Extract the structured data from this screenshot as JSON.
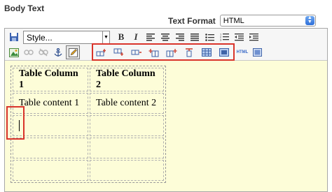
{
  "field": {
    "label": "Body Text"
  },
  "format": {
    "label": "Text Format",
    "selected": "HTML"
  },
  "toolbar": {
    "style_select": "Style...",
    "bold": "B",
    "italic": "I",
    "html_button": "HTML"
  },
  "table": {
    "headers": [
      "Table Column 1",
      "Table Column 2"
    ],
    "rows": [
      [
        "Table content 1",
        "Table content 2"
      ],
      [
        "",
        ""
      ],
      [
        "",
        ""
      ],
      [
        "",
        ""
      ]
    ]
  },
  "colors": {
    "highlight": "#d9342b",
    "editor_bg": "#fdfdd8",
    "select_accent": "#2f6fd9"
  }
}
